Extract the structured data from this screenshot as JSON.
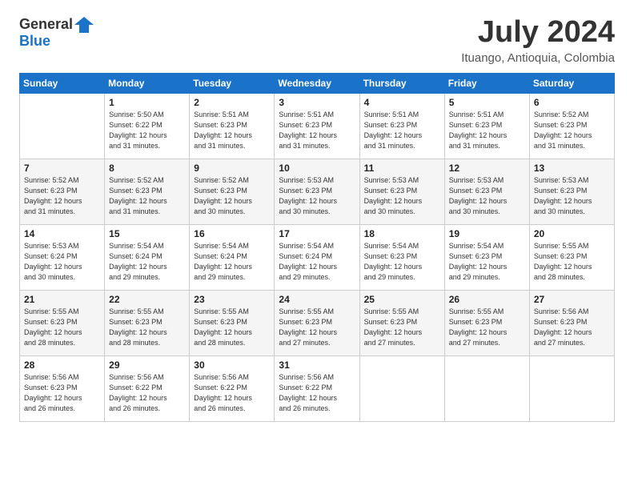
{
  "header": {
    "logo_general": "General",
    "logo_blue": "Blue",
    "month_year": "July 2024",
    "location": "Ituango, Antioquia, Colombia"
  },
  "weekdays": [
    "Sunday",
    "Monday",
    "Tuesday",
    "Wednesday",
    "Thursday",
    "Friday",
    "Saturday"
  ],
  "weeks": [
    [
      {
        "day": "",
        "info": ""
      },
      {
        "day": "1",
        "info": "Sunrise: 5:50 AM\nSunset: 6:22 PM\nDaylight: 12 hours\nand 31 minutes."
      },
      {
        "day": "2",
        "info": "Sunrise: 5:51 AM\nSunset: 6:23 PM\nDaylight: 12 hours\nand 31 minutes."
      },
      {
        "day": "3",
        "info": "Sunrise: 5:51 AM\nSunset: 6:23 PM\nDaylight: 12 hours\nand 31 minutes."
      },
      {
        "day": "4",
        "info": "Sunrise: 5:51 AM\nSunset: 6:23 PM\nDaylight: 12 hours\nand 31 minutes."
      },
      {
        "day": "5",
        "info": "Sunrise: 5:51 AM\nSunset: 6:23 PM\nDaylight: 12 hours\nand 31 minutes."
      },
      {
        "day": "6",
        "info": "Sunrise: 5:52 AM\nSunset: 6:23 PM\nDaylight: 12 hours\nand 31 minutes."
      }
    ],
    [
      {
        "day": "7",
        "info": "Sunrise: 5:52 AM\nSunset: 6:23 PM\nDaylight: 12 hours\nand 31 minutes."
      },
      {
        "day": "8",
        "info": "Sunrise: 5:52 AM\nSunset: 6:23 PM\nDaylight: 12 hours\nand 31 minutes."
      },
      {
        "day": "9",
        "info": "Sunrise: 5:52 AM\nSunset: 6:23 PM\nDaylight: 12 hours\nand 30 minutes."
      },
      {
        "day": "10",
        "info": "Sunrise: 5:53 AM\nSunset: 6:23 PM\nDaylight: 12 hours\nand 30 minutes."
      },
      {
        "day": "11",
        "info": "Sunrise: 5:53 AM\nSunset: 6:23 PM\nDaylight: 12 hours\nand 30 minutes."
      },
      {
        "day": "12",
        "info": "Sunrise: 5:53 AM\nSunset: 6:23 PM\nDaylight: 12 hours\nand 30 minutes."
      },
      {
        "day": "13",
        "info": "Sunrise: 5:53 AM\nSunset: 6:23 PM\nDaylight: 12 hours\nand 30 minutes."
      }
    ],
    [
      {
        "day": "14",
        "info": "Sunrise: 5:53 AM\nSunset: 6:24 PM\nDaylight: 12 hours\nand 30 minutes."
      },
      {
        "day": "15",
        "info": "Sunrise: 5:54 AM\nSunset: 6:24 PM\nDaylight: 12 hours\nand 29 minutes."
      },
      {
        "day": "16",
        "info": "Sunrise: 5:54 AM\nSunset: 6:24 PM\nDaylight: 12 hours\nand 29 minutes."
      },
      {
        "day": "17",
        "info": "Sunrise: 5:54 AM\nSunset: 6:24 PM\nDaylight: 12 hours\nand 29 minutes."
      },
      {
        "day": "18",
        "info": "Sunrise: 5:54 AM\nSunset: 6:23 PM\nDaylight: 12 hours\nand 29 minutes."
      },
      {
        "day": "19",
        "info": "Sunrise: 5:54 AM\nSunset: 6:23 PM\nDaylight: 12 hours\nand 29 minutes."
      },
      {
        "day": "20",
        "info": "Sunrise: 5:55 AM\nSunset: 6:23 PM\nDaylight: 12 hours\nand 28 minutes."
      }
    ],
    [
      {
        "day": "21",
        "info": "Sunrise: 5:55 AM\nSunset: 6:23 PM\nDaylight: 12 hours\nand 28 minutes."
      },
      {
        "day": "22",
        "info": "Sunrise: 5:55 AM\nSunset: 6:23 PM\nDaylight: 12 hours\nand 28 minutes."
      },
      {
        "day": "23",
        "info": "Sunrise: 5:55 AM\nSunset: 6:23 PM\nDaylight: 12 hours\nand 28 minutes."
      },
      {
        "day": "24",
        "info": "Sunrise: 5:55 AM\nSunset: 6:23 PM\nDaylight: 12 hours\nand 27 minutes."
      },
      {
        "day": "25",
        "info": "Sunrise: 5:55 AM\nSunset: 6:23 PM\nDaylight: 12 hours\nand 27 minutes."
      },
      {
        "day": "26",
        "info": "Sunrise: 5:55 AM\nSunset: 6:23 PM\nDaylight: 12 hours\nand 27 minutes."
      },
      {
        "day": "27",
        "info": "Sunrise: 5:56 AM\nSunset: 6:23 PM\nDaylight: 12 hours\nand 27 minutes."
      }
    ],
    [
      {
        "day": "28",
        "info": "Sunrise: 5:56 AM\nSunset: 6:23 PM\nDaylight: 12 hours\nand 26 minutes."
      },
      {
        "day": "29",
        "info": "Sunrise: 5:56 AM\nSunset: 6:22 PM\nDaylight: 12 hours\nand 26 minutes."
      },
      {
        "day": "30",
        "info": "Sunrise: 5:56 AM\nSunset: 6:22 PM\nDaylight: 12 hours\nand 26 minutes."
      },
      {
        "day": "31",
        "info": "Sunrise: 5:56 AM\nSunset: 6:22 PM\nDaylight: 12 hours\nand 26 minutes."
      },
      {
        "day": "",
        "info": ""
      },
      {
        "day": "",
        "info": ""
      },
      {
        "day": "",
        "info": ""
      }
    ]
  ]
}
